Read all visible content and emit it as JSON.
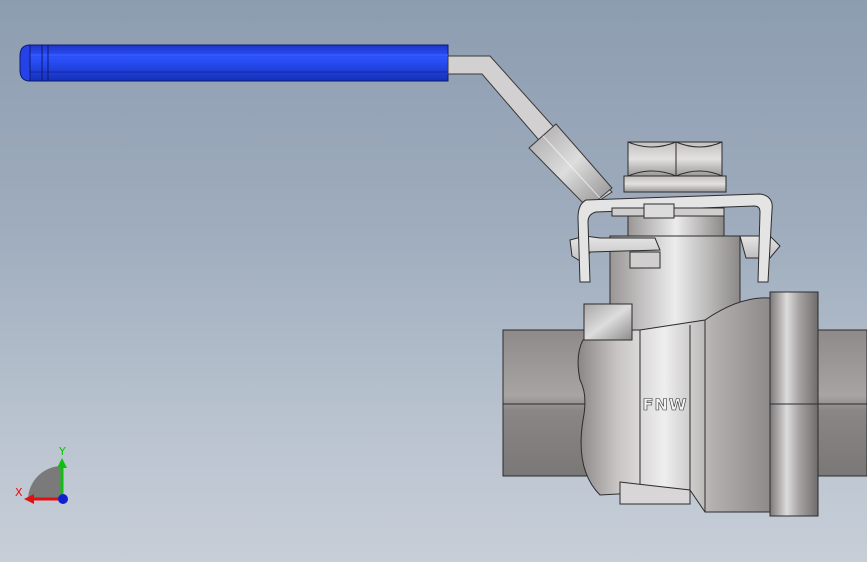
{
  "model": {
    "brand_mark": "FNW",
    "handle_color": "#1f3fe0"
  },
  "triad": {
    "x_label": "X",
    "y_label": "Y",
    "x_color": "#e01010",
    "y_color": "#10c010",
    "z_color": "#1020d0"
  }
}
